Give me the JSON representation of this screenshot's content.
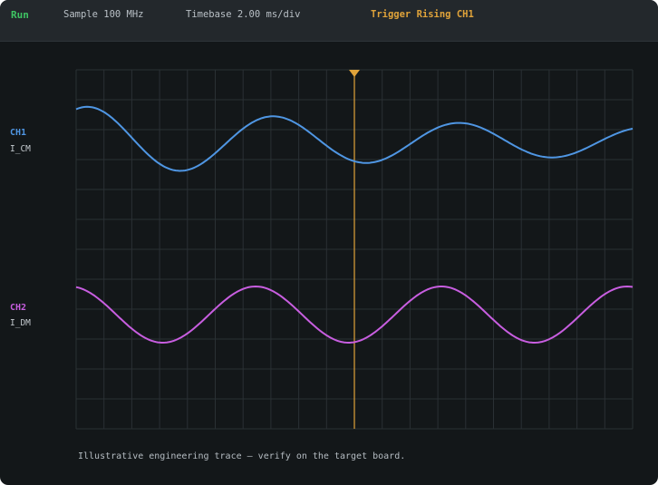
{
  "toolbar": {
    "run_label": "Run",
    "sample": "Sample 100 MHz",
    "timebase": "Timebase 2.00 ms/div",
    "trigger": "Trigger Rising CH1"
  },
  "channels": [
    {
      "label": "CH1",
      "signal": "I_CM",
      "color": "#4f96e3"
    },
    {
      "label": "CH2",
      "signal": "I_DM",
      "color": "#c85ee0"
    }
  ],
  "colors": {
    "run": "#3ec463",
    "trigger": "#e0a33a",
    "background": "#131719",
    "grid": "#2a3034"
  },
  "footnote": "Illustrative engineering trace — verify on the target board."
}
